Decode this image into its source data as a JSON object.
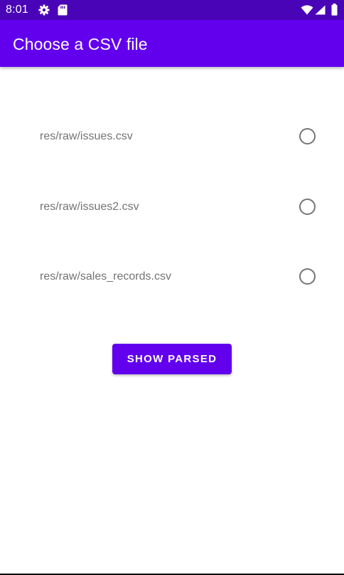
{
  "status_bar": {
    "time": "8:01",
    "left_icons": [
      "gear-icon",
      "sd-card-icon"
    ],
    "right_icons": [
      "wifi-icon",
      "cell-signal-icon",
      "battery-icon"
    ]
  },
  "app_bar": {
    "title": "Choose a CSV file"
  },
  "radio_group": {
    "options": [
      {
        "label": "res/raw/issues.csv",
        "selected": false
      },
      {
        "label": "res/raw/issues2.csv",
        "selected": false
      },
      {
        "label": "res/raw/sales_records.csv",
        "selected": false
      }
    ]
  },
  "actions": {
    "show_parsed_label": "SHOW PARSED"
  },
  "colors": {
    "status_bar": "#4a04b8",
    "primary": "#6200ee",
    "label_text": "#737373",
    "radio_outline": "#757575"
  }
}
